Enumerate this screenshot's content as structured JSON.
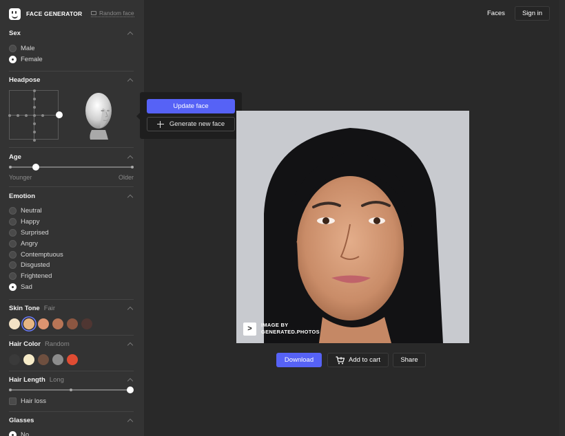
{
  "brand": {
    "name": "FACE GENERATOR",
    "random_face": "Random face"
  },
  "sections": {
    "sex": {
      "title": "Sex",
      "options": [
        "Male",
        "Female"
      ],
      "selected": "Female"
    },
    "headpose": {
      "title": "Headpose"
    },
    "age": {
      "title": "Age",
      "min_label": "Younger",
      "max_label": "Older",
      "value_fraction": 0.2
    },
    "emotion": {
      "title": "Emotion",
      "options": [
        "Neutral",
        "Happy",
        "Surprised",
        "Angry",
        "Contemptuous",
        "Disgusted",
        "Frightened",
        "Sad"
      ],
      "selected": "Sad"
    },
    "skin_tone": {
      "title": "Skin Tone",
      "value": "Fair",
      "colors": [
        "#f3e2c5",
        "#e7b583",
        "#dd9470",
        "#b87556",
        "#8c5641",
        "#4f3632"
      ],
      "selected_index": 1
    },
    "hair_color": {
      "title": "Hair Color",
      "value": "Random",
      "colors": [
        "#3a3a3a",
        "#f6ebc8",
        "#6e4f3f",
        "#8c8c8c",
        "#e04c33"
      ]
    },
    "hair_length": {
      "title": "Hair Length",
      "value": "Long",
      "value_fraction": 1.0,
      "hair_loss_label": "Hair loss"
    },
    "glasses": {
      "title": "Glasses",
      "first_option": "No"
    }
  },
  "popup": {
    "update": "Update face",
    "generate": "Generate new face"
  },
  "header": {
    "faces": "Faces",
    "sign_in": "Sign in"
  },
  "image": {
    "watermark_line1": "IMAGE BY",
    "watermark_line2": "GENERATED.PHOTOS",
    "watermark_icon": ">"
  },
  "actions": {
    "download": "Download",
    "add_to_cart": "Add to cart",
    "share": "Share"
  },
  "colors": {
    "accent": "#5662f6",
    "sidebar": "#333333",
    "canvas": "#292929"
  }
}
